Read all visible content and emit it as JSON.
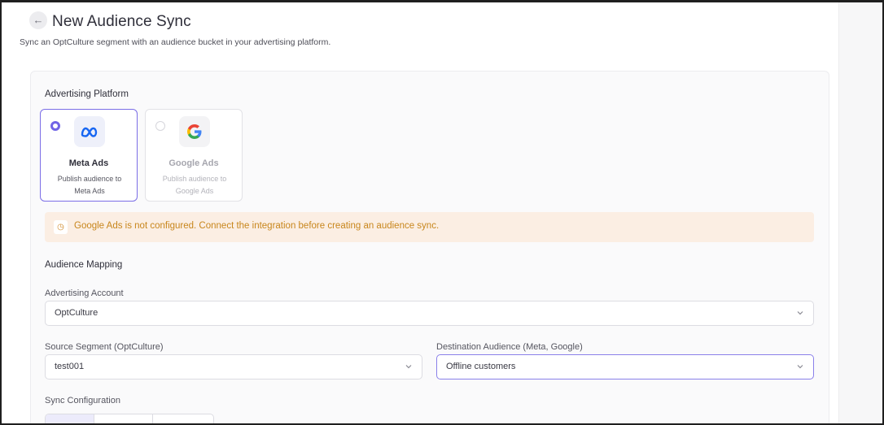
{
  "header": {
    "back_icon": "arrow-left-icon",
    "title": "New Audience Sync",
    "subtitle": "Sync an OptCulture segment with an audience bucket in your advertising platform."
  },
  "advertising_platform": {
    "label": "Advertising Platform",
    "options": [
      {
        "name": "Meta Ads",
        "description": "Publish audience to Meta Ads",
        "selected": true,
        "disabled": false,
        "icon": "meta-logo-icon",
        "color": "#1877F2"
      },
      {
        "name": "Google Ads",
        "description": "Publish audience to Google Ads",
        "selected": false,
        "disabled": true,
        "icon": "google-logo-icon"
      }
    ]
  },
  "warning": {
    "icon": "warning-clock-icon",
    "text": "Google Ads is not configured. Connect the integration before creating an audience sync.",
    "color": "#c8861c",
    "background": "#fbeee3"
  },
  "audience_mapping": {
    "label": "Audience Mapping",
    "advertising_account": {
      "label": "Advertising Account",
      "value": "OptCulture"
    },
    "source_segment": {
      "label": "Source Segment (OptCulture)",
      "value": "test001"
    },
    "destination_audience": {
      "label": "Destination Audience (Meta, Google)",
      "value": "Offline customers"
    }
  },
  "sync_configuration": {
    "label": "Sync Configuration"
  },
  "colors": {
    "accent": "#7064e6",
    "panel_bg": "#fafafb"
  }
}
